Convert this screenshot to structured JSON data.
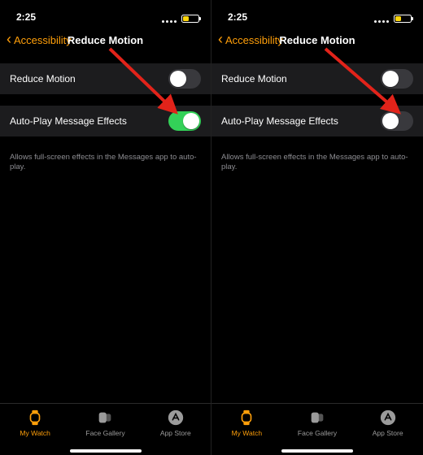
{
  "colors": {
    "accent": "#ff9f0a",
    "toggle_on": "#33d158",
    "battery_fill": "#ffd60a",
    "grey": "#9b9b9b",
    "arrow": "#e2231a"
  },
  "battery_pct": 40,
  "status": {
    "time": "2:25"
  },
  "header": {
    "back_label": "Accessibility",
    "title": "Reduce Motion"
  },
  "rows": {
    "reduce_motion": {
      "label": "Reduce Motion"
    },
    "auto_play": {
      "label": "Auto-Play Message Effects"
    }
  },
  "footer_note": "Allows full-screen effects in the Messages app to auto-play.",
  "tabs": {
    "my_watch": {
      "label": "My Watch"
    },
    "face_gallery": {
      "label": "Face Gallery"
    },
    "app_store": {
      "label": "App Store"
    }
  },
  "screens": [
    {
      "auto_play_on": true
    },
    {
      "auto_play_on": false
    }
  ]
}
